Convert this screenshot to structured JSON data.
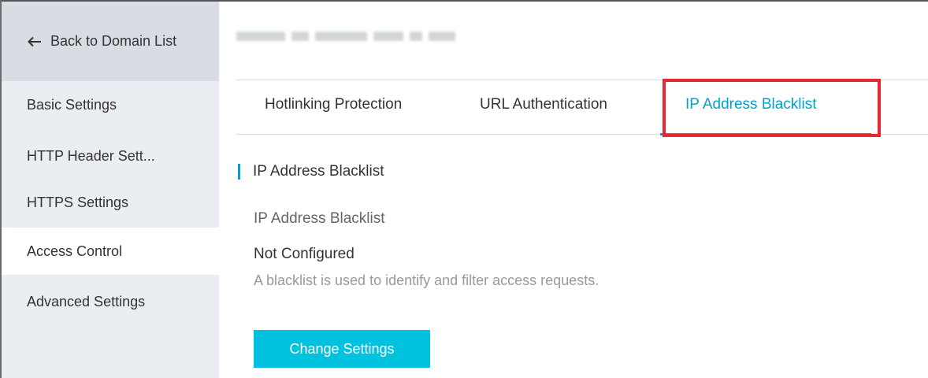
{
  "sidebar": {
    "back_label": "Back to Domain List",
    "items": [
      {
        "label": "Basic Settings"
      },
      {
        "label": "HTTP Header Sett..."
      },
      {
        "label": "HTTPS Settings"
      },
      {
        "label": "Access Control",
        "active": true
      },
      {
        "label": "Advanced Settings"
      }
    ]
  },
  "tabs": [
    {
      "label": "Hotlinking Protection"
    },
    {
      "label": "URL Authentication"
    },
    {
      "label": "IP Address Blacklist",
      "active": true
    }
  ],
  "section": {
    "title": "IP Address Blacklist"
  },
  "field": {
    "label": "IP Address Blacklist",
    "value": "Not Configured",
    "help": "A blacklist is used to identify and filter access requests."
  },
  "actions": {
    "change_settings_label": "Change Settings"
  },
  "colors": {
    "accent": "#00a2ca",
    "button": "#00c1de",
    "highlight": "#e8272f",
    "sidebar_bg": "#eaedf1"
  }
}
